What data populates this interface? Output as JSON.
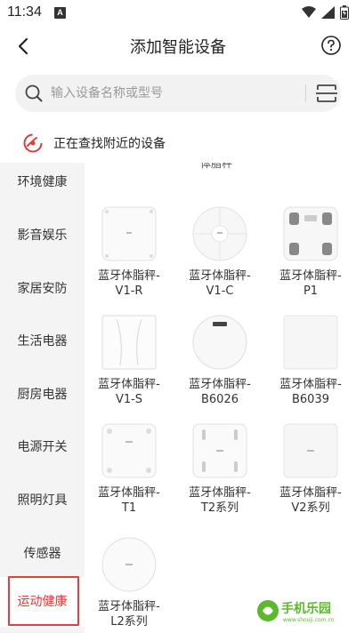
{
  "status_bar": {
    "time": "11:34",
    "notif_letter": "A"
  },
  "header": {
    "title": "添加智能设备"
  },
  "search": {
    "placeholder": "输入设备名称或型号"
  },
  "scan": {
    "text": "正在查找附近的设备"
  },
  "sidebar": {
    "items": [
      {
        "label": "环境健康"
      },
      {
        "label": "影音娱乐"
      },
      {
        "label": "家居安防"
      },
      {
        "label": "生活电器"
      },
      {
        "label": "厨房电器"
      },
      {
        "label": "电源开关"
      },
      {
        "label": "照明灯具"
      },
      {
        "label": "传感器"
      },
      {
        "label": "运动健康"
      }
    ],
    "active": "运动健康"
  },
  "content": {
    "section_label_partial": "体脂秤",
    "devices": [
      {
        "name": "蓝牙体脂秤-",
        "model": "V1-R",
        "icon": "scale-square-icon"
      },
      {
        "name": "蓝牙体脂秤-",
        "model": "V1-C",
        "icon": "scale-round-petal-icon"
      },
      {
        "name": "蓝牙体脂秤-",
        "model": "P1",
        "icon": "scale-pads-icon"
      },
      {
        "name": "蓝牙体脂秤-",
        "model": "V1-S",
        "icon": "scale-silhouette-icon"
      },
      {
        "name": "蓝牙体脂秤-",
        "model": "B6026",
        "icon": "scale-round-display-icon"
      },
      {
        "name": "蓝牙体脂秤-",
        "model": "B6039",
        "icon": "scale-plain-icon"
      },
      {
        "name": "蓝牙体脂秤-",
        "model": "T1",
        "icon": "scale-dots-icon"
      },
      {
        "name": "蓝牙体脂秤-",
        "model": "T2系列",
        "icon": "scale-electrodes-icon"
      },
      {
        "name": "蓝牙体脂秤-",
        "model": "V2系列",
        "icon": "scale-glass-icon"
      },
      {
        "name": "蓝牙体脂秤-",
        "model": "L2系列",
        "icon": "scale-round-icon"
      }
    ]
  },
  "watermark": {
    "text": "手机乐园",
    "url": "www.shouji.com.cn"
  },
  "colors": {
    "accent": "#e43a3a",
    "sidebar_bg": "#f4f4f4",
    "search_bg": "#f2f2f2",
    "watermark_green": "#5cb82e"
  }
}
